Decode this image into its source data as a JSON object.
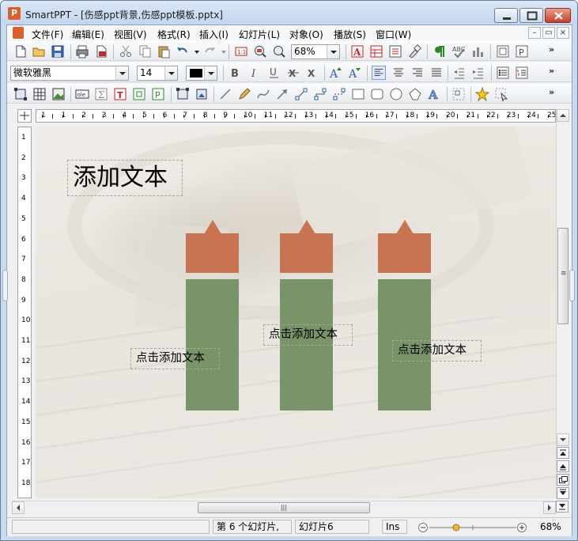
{
  "window": {
    "app_icon_letter": "P",
    "title": "SmartPPT - [伤感ppt背景,伤感ppt模板.pptx]"
  },
  "menu": [
    "文件(F)",
    "编辑(E)",
    "视图(V)",
    "格式(R)",
    "插入(I)",
    "幻灯片(L)",
    "对象(O)",
    "播放(S)",
    "窗口(W)"
  ],
  "mdi_controls": [
    "–",
    "▭",
    "×"
  ],
  "toolbar1": {
    "zoom_value": "68%",
    "more": "»"
  },
  "toolbar2": {
    "font_name": "微软雅黑",
    "font_size": "14",
    "more": "»"
  },
  "toolbar3": {
    "more": "»"
  },
  "ruler_h": [
    "1",
    "1",
    "2",
    "3",
    "4",
    "5",
    "6",
    "7",
    "8",
    "9",
    "10",
    "11",
    "12",
    "13",
    "14",
    "15",
    "16",
    "17",
    "18",
    "19",
    "20",
    "21",
    "22",
    "23",
    "24",
    "25"
  ],
  "ruler_v": [
    "1",
    "2",
    "3",
    "4",
    "5",
    "6",
    "7",
    "8",
    "9",
    "10",
    "11",
    "12",
    "13",
    "14",
    "15",
    "16",
    "17",
    "18"
  ],
  "slide": {
    "title_text": "添加文本",
    "text_boxes": [
      "点击添加文本",
      "点击添加文本",
      "点击添加文本"
    ],
    "colors": {
      "cap": "#c87352",
      "bar": "#7a946a"
    }
  },
  "hscroll_grip": "|||",
  "vscroll_grip": "≡",
  "status": {
    "cell1": "",
    "slide_count": "第 6 个幻灯片,",
    "slide_name": "幻灯片6",
    "mode": "Ins",
    "zoom": "68%"
  }
}
